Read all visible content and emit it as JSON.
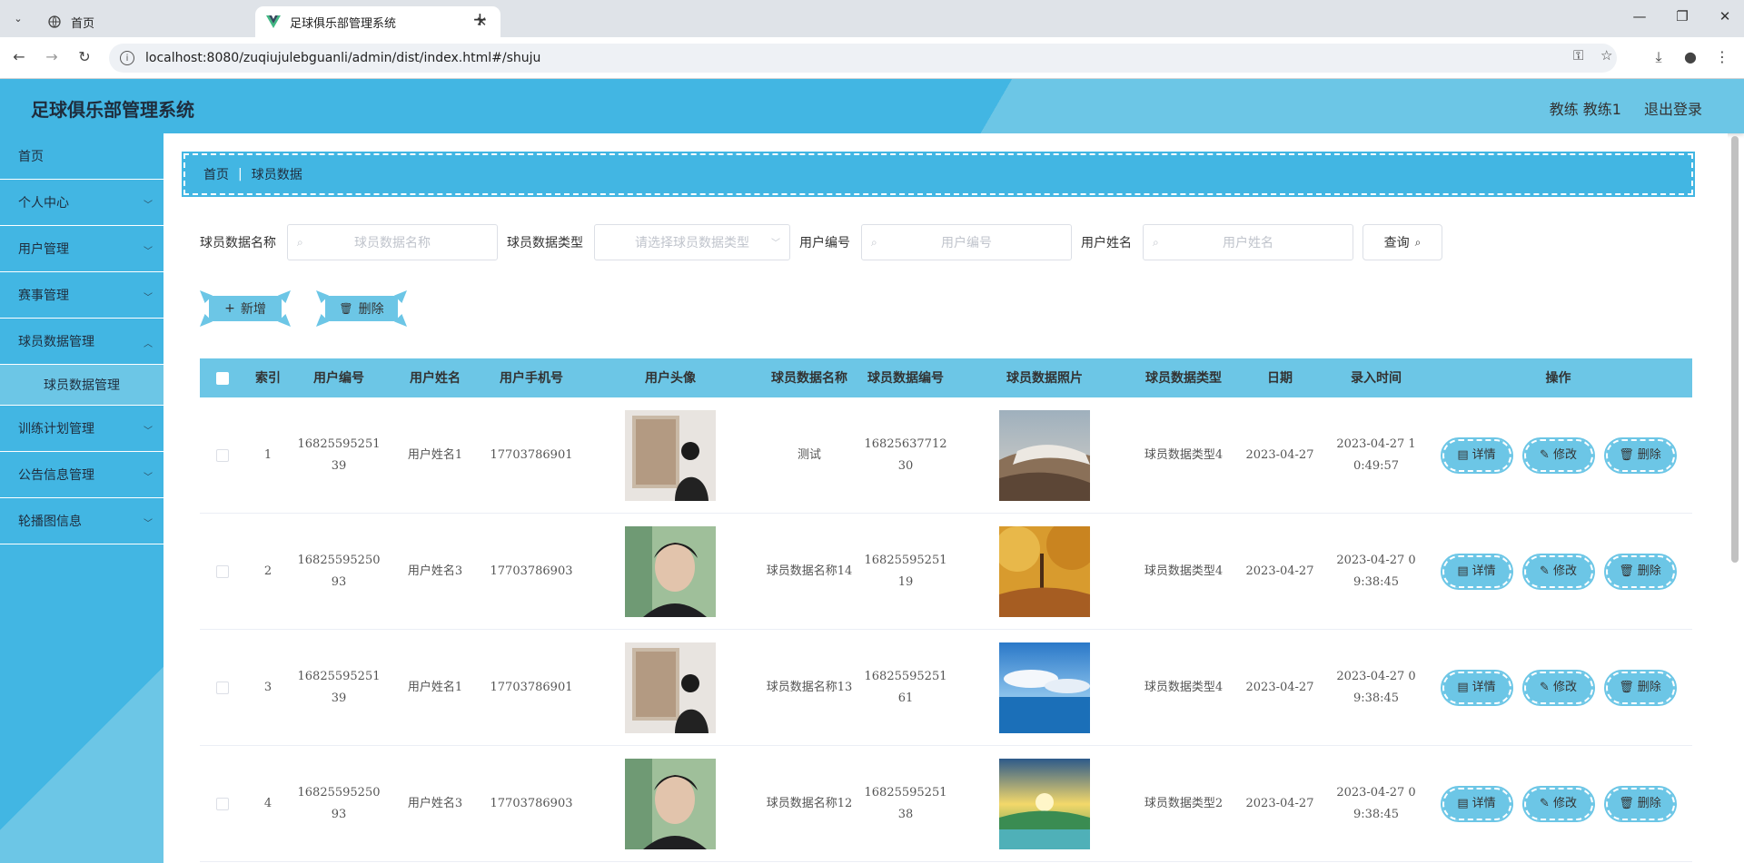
{
  "browser": {
    "tabs": [
      {
        "title": "首页"
      },
      {
        "title": "足球俱乐部管理系统"
      }
    ],
    "url": "localhost:8080/zuqiujulebguanli/admin/dist/index.html#/shuju"
  },
  "header": {
    "title": "足球俱乐部管理系统",
    "user": "教练 教练1",
    "logout": "退出登录"
  },
  "sidebar": {
    "items": [
      {
        "label": "首页",
        "has_children": false
      },
      {
        "label": "个人中心",
        "has_children": true
      },
      {
        "label": "用户管理",
        "has_children": true
      },
      {
        "label": "赛事管理",
        "has_children": true
      },
      {
        "label": "球员数据管理",
        "has_children": true
      },
      {
        "label": "训练计划管理",
        "has_children": true
      },
      {
        "label": "公告信息管理",
        "has_children": true
      },
      {
        "label": "轮播图信息",
        "has_children": true
      }
    ],
    "subitem": "球员数据管理"
  },
  "breadcrumb": {
    "home": "首页",
    "sep": "|",
    "current": "球员数据"
  },
  "search": {
    "name_label": "球员数据名称",
    "name_placeholder": "球员数据名称",
    "type_label": "球员数据类型",
    "type_placeholder": "请选择球员数据类型",
    "uno_label": "用户编号",
    "uno_placeholder": "用户编号",
    "uname_label": "用户姓名",
    "uname_placeholder": "用户姓名",
    "query": "查询"
  },
  "actions": {
    "add": "新增",
    "delete": "删除"
  },
  "table": {
    "headers": [
      "索引",
      "用户编号",
      "用户姓名",
      "用户手机号",
      "用户头像",
      "球员数据名称",
      "球员数据编号",
      "球员数据照片",
      "球员数据类型",
      "日期",
      "录入时间",
      "操作"
    ],
    "ops": {
      "detail": "详情",
      "edit": "修改",
      "delete": "删除"
    },
    "rows": [
      {
        "index": "1",
        "user_no": "1682559525139",
        "user_name": "用户姓名1",
        "phone": "17703786901",
        "data_name": "测试",
        "data_no": "1682563771230",
        "data_type": "球员数据类型4",
        "date": "2023-04-27",
        "time": "2023-04-27 10:49:57"
      },
      {
        "index": "2",
        "user_no": "1682559525093",
        "user_name": "用户姓名3",
        "phone": "17703786903",
        "data_name": "球员数据名称14",
        "data_no": "1682559525119",
        "data_type": "球员数据类型4",
        "date": "2023-04-27",
        "time": "2023-04-27 09:38:45"
      },
      {
        "index": "3",
        "user_no": "1682559525139",
        "user_name": "用户姓名1",
        "phone": "17703786901",
        "data_name": "球员数据名称13",
        "data_no": "1682559525161",
        "data_type": "球员数据类型4",
        "date": "2023-04-27",
        "time": "2023-04-27 09:38:45"
      },
      {
        "index": "4",
        "user_no": "1682559525093",
        "user_name": "用户姓名3",
        "phone": "17703786903",
        "data_name": "球员数据名称12",
        "data_no": "1682559525138",
        "data_type": "球员数据类型2",
        "date": "2023-04-27",
        "time": "2023-04-27 09:38:45"
      }
    ]
  },
  "colors": {
    "primary": "#42b6e3",
    "light": "#6cc6e6"
  }
}
